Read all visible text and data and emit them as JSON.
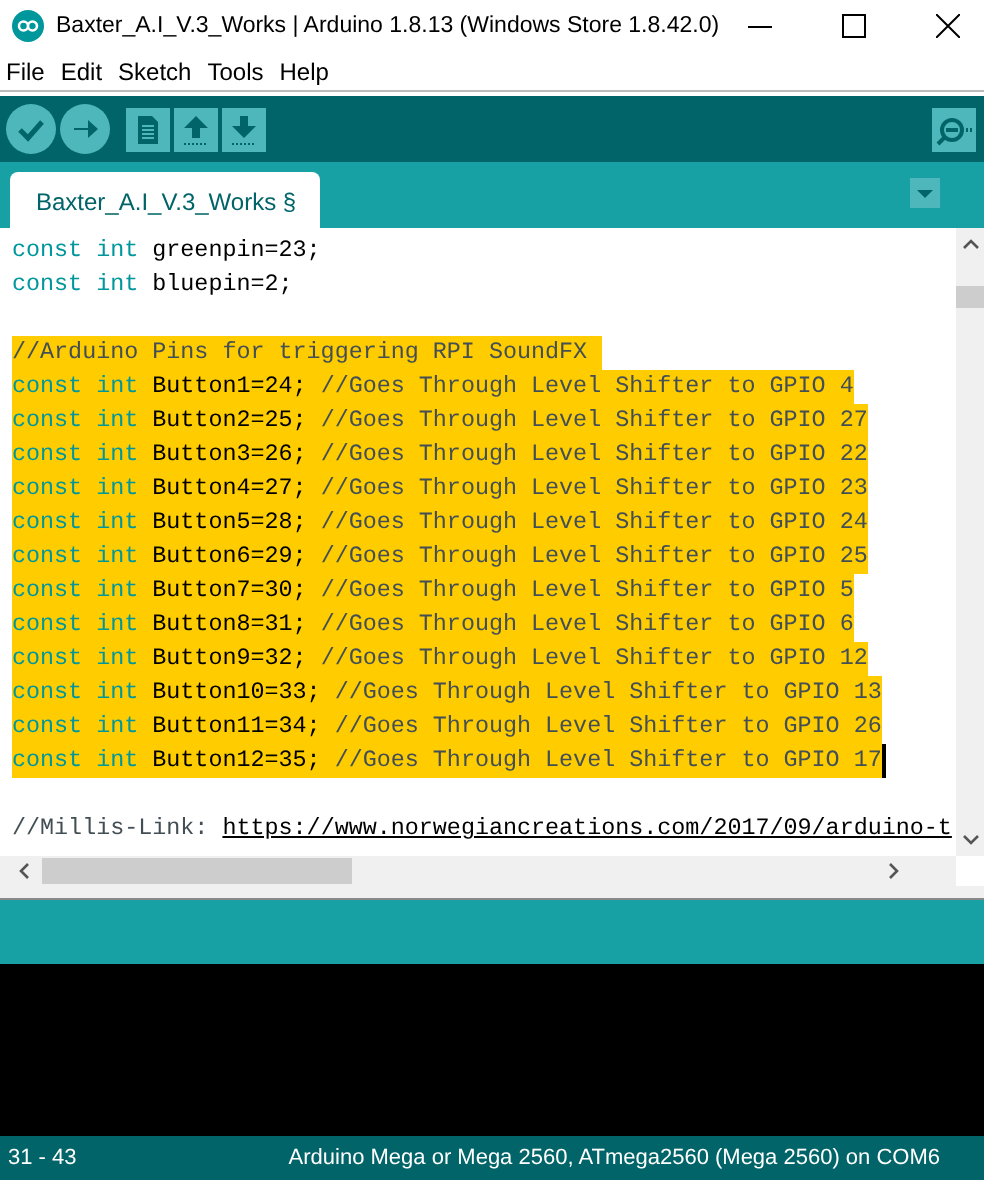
{
  "window": {
    "title": "Baxter_A.I_V.3_Works | Arduino 1.8.13 (Windows Store 1.8.42.0)"
  },
  "menu": [
    {
      "label": "File"
    },
    {
      "label": "Edit"
    },
    {
      "label": "Sketch"
    },
    {
      "label": "Tools"
    },
    {
      "label": "Help"
    }
  ],
  "tabs": [
    {
      "label": "Baxter_A.I_V.3_Works §",
      "selected": true
    }
  ],
  "editor": {
    "lines": [
      {
        "kind": "code",
        "selected": false,
        "segments": [
          {
            "kind": "keyword",
            "text": "const int"
          },
          {
            "kind": "plain",
            "text": " greenpin=23;"
          }
        ]
      },
      {
        "kind": "code",
        "selected": false,
        "segments": [
          {
            "kind": "keyword",
            "text": "const int"
          },
          {
            "kind": "plain",
            "text": " bluepin=2;"
          }
        ]
      },
      {
        "kind": "blank"
      },
      {
        "kind": "code",
        "selected": true,
        "segments": [
          {
            "kind": "comment",
            "text": "//Arduino Pins for triggering RPI SoundFX "
          }
        ]
      },
      {
        "kind": "code",
        "selected": true,
        "segments": [
          {
            "kind": "keyword",
            "text": "const int"
          },
          {
            "kind": "plain",
            "text": " Button1=24; "
          },
          {
            "kind": "comment",
            "text": "//Goes Through Level Shifter to GPIO 4"
          }
        ]
      },
      {
        "kind": "code",
        "selected": true,
        "segments": [
          {
            "kind": "keyword",
            "text": "const int"
          },
          {
            "kind": "plain",
            "text": " Button2=25; "
          },
          {
            "kind": "comment",
            "text": "//Goes Through Level Shifter to GPIO 27"
          }
        ]
      },
      {
        "kind": "code",
        "selected": true,
        "segments": [
          {
            "kind": "keyword",
            "text": "const int"
          },
          {
            "kind": "plain",
            "text": " Button3=26; "
          },
          {
            "kind": "comment",
            "text": "//Goes Through Level Shifter to GPIO 22"
          }
        ]
      },
      {
        "kind": "code",
        "selected": true,
        "segments": [
          {
            "kind": "keyword",
            "text": "const int"
          },
          {
            "kind": "plain",
            "text": " Button4=27; "
          },
          {
            "kind": "comment",
            "text": "//Goes Through Level Shifter to GPIO 23"
          }
        ]
      },
      {
        "kind": "code",
        "selected": true,
        "segments": [
          {
            "kind": "keyword",
            "text": "const int"
          },
          {
            "kind": "plain",
            "text": " Button5=28; "
          },
          {
            "kind": "comment",
            "text": "//Goes Through Level Shifter to GPIO 24"
          }
        ]
      },
      {
        "kind": "code",
        "selected": true,
        "segments": [
          {
            "kind": "keyword",
            "text": "const int"
          },
          {
            "kind": "plain",
            "text": " Button6=29; "
          },
          {
            "kind": "comment",
            "text": "//Goes Through Level Shifter to GPIO 25"
          }
        ]
      },
      {
        "kind": "code",
        "selected": true,
        "segments": [
          {
            "kind": "keyword",
            "text": "const int"
          },
          {
            "kind": "plain",
            "text": " Button7=30; "
          },
          {
            "kind": "comment",
            "text": "//Goes Through Level Shifter to GPIO 5"
          }
        ]
      },
      {
        "kind": "code",
        "selected": true,
        "segments": [
          {
            "kind": "keyword",
            "text": "const int"
          },
          {
            "kind": "plain",
            "text": " Button8=31; "
          },
          {
            "kind": "comment",
            "text": "//Goes Through Level Shifter to GPIO 6"
          }
        ]
      },
      {
        "kind": "code",
        "selected": true,
        "segments": [
          {
            "kind": "keyword",
            "text": "const int"
          },
          {
            "kind": "plain",
            "text": " Button9=32; "
          },
          {
            "kind": "comment",
            "text": "//Goes Through Level Shifter to GPIO 12"
          }
        ]
      },
      {
        "kind": "code",
        "selected": true,
        "segments": [
          {
            "kind": "keyword",
            "text": "const int"
          },
          {
            "kind": "plain",
            "text": " Button10=33; "
          },
          {
            "kind": "comment",
            "text": "//Goes Through Level Shifter to GPIO 13"
          }
        ]
      },
      {
        "kind": "code",
        "selected": true,
        "segments": [
          {
            "kind": "keyword",
            "text": "const int"
          },
          {
            "kind": "plain",
            "text": " Button11=34; "
          },
          {
            "kind": "comment",
            "text": "//Goes Through Level Shifter to GPIO 26"
          }
        ]
      },
      {
        "kind": "code",
        "selected": true,
        "cursor": true,
        "segments": [
          {
            "kind": "keyword",
            "text": "const int"
          },
          {
            "kind": "plain",
            "text": " Button12=35; "
          },
          {
            "kind": "comment",
            "text": "//Goes Through Level Shifter to GPIO 17"
          }
        ]
      },
      {
        "kind": "blank"
      },
      {
        "kind": "code",
        "selected": false,
        "segments": [
          {
            "kind": "comment",
            "text": "//Millis-Link: "
          },
          {
            "kind": "link",
            "text": "https://www.norwegiancreations.com/2017/09/arduino-t"
          }
        ]
      }
    ]
  },
  "status_bar": {
    "position": "31 - 43",
    "board": "Arduino Mega or Mega 2560, ATmega2560 (Mega 2560) on COM6"
  }
}
